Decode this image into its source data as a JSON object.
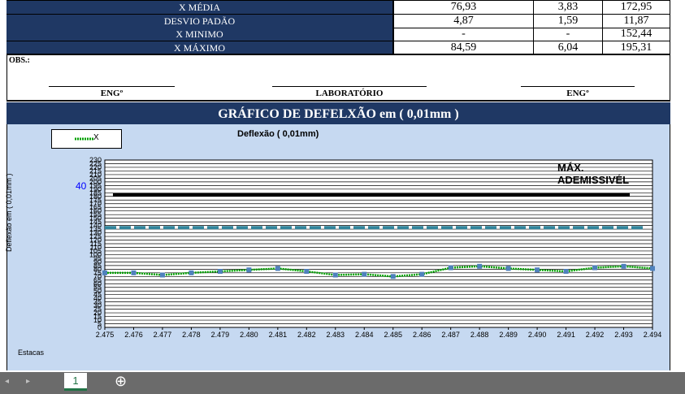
{
  "stats": [
    {
      "label": "X MÉDIA",
      "c1": "76,93",
      "c2": "3,83",
      "c3": "172,95"
    },
    {
      "label": "DESVIO PADÃO",
      "c1": "4,87",
      "c2": "1,59",
      "c3": "11,87"
    },
    {
      "label": "X MINIMO",
      "c1": "-",
      "c2": "-",
      "c3": "152,44"
    },
    {
      "label": "X MÁXIMO",
      "c1": "84,59",
      "c2": "6,04",
      "c3": "195,31"
    }
  ],
  "obs_label": "OBS.:",
  "signatures": [
    "ENGº",
    "LABORATÓRIO",
    "ENGº"
  ],
  "chart_header": "GRÁFICO  DE DEFELXÃO em ( 0,01mm )",
  "colors": {
    "header_bg": "#1f3864",
    "chart_bg": "#c6d9f1",
    "series_line": "#00a000",
    "series_marker": "#4f81bd",
    "max_line": "#000000",
    "dash_line": "#31859c"
  },
  "chart_data": {
    "type": "line",
    "title": "Deflexão ( 0,01mm)",
    "xlabel": "Estacas",
    "ylabel": "Deflexão em ( 0,01mm )",
    "ylim": [
      0,
      230
    ],
    "yticks": [
      0,
      5,
      10,
      15,
      20,
      25,
      30,
      35,
      40,
      45,
      50,
      55,
      60,
      65,
      70,
      75,
      80,
      85,
      90,
      95,
      100,
      105,
      110,
      115,
      120,
      125,
      130,
      135,
      140,
      145,
      150,
      155,
      160,
      165,
      170,
      175,
      180,
      185,
      190,
      195,
      200,
      205,
      210,
      215,
      220,
      225,
      230
    ],
    "categories": [
      "2.475",
      "2.476",
      "2.477",
      "2.478",
      "2.479",
      "2.480",
      "2.481",
      "2.482",
      "2.483",
      "2.484",
      "2.485",
      "2.486",
      "2.487",
      "2.488",
      "2.489",
      "2.490",
      "2.491",
      "2.492",
      "2.493",
      "2.494"
    ],
    "grid": true,
    "legend": {
      "placement": "top-left",
      "label": "X"
    },
    "series": [
      {
        "name": "X",
        "values": [
          75,
          75,
          72,
          75,
          77,
          79,
          81,
          77,
          72,
          73,
          70,
          73,
          82,
          84,
          81,
          79,
          77,
          82,
          84,
          81
        ]
      }
    ],
    "reference_lines": [
      {
        "label": "MÁX. ADEMISSIVÉL",
        "value": 182
      },
      {
        "value": 137
      }
    ],
    "annotation": "40"
  },
  "sheet_tab": "1",
  "add_sheet_symbol": "⊕"
}
